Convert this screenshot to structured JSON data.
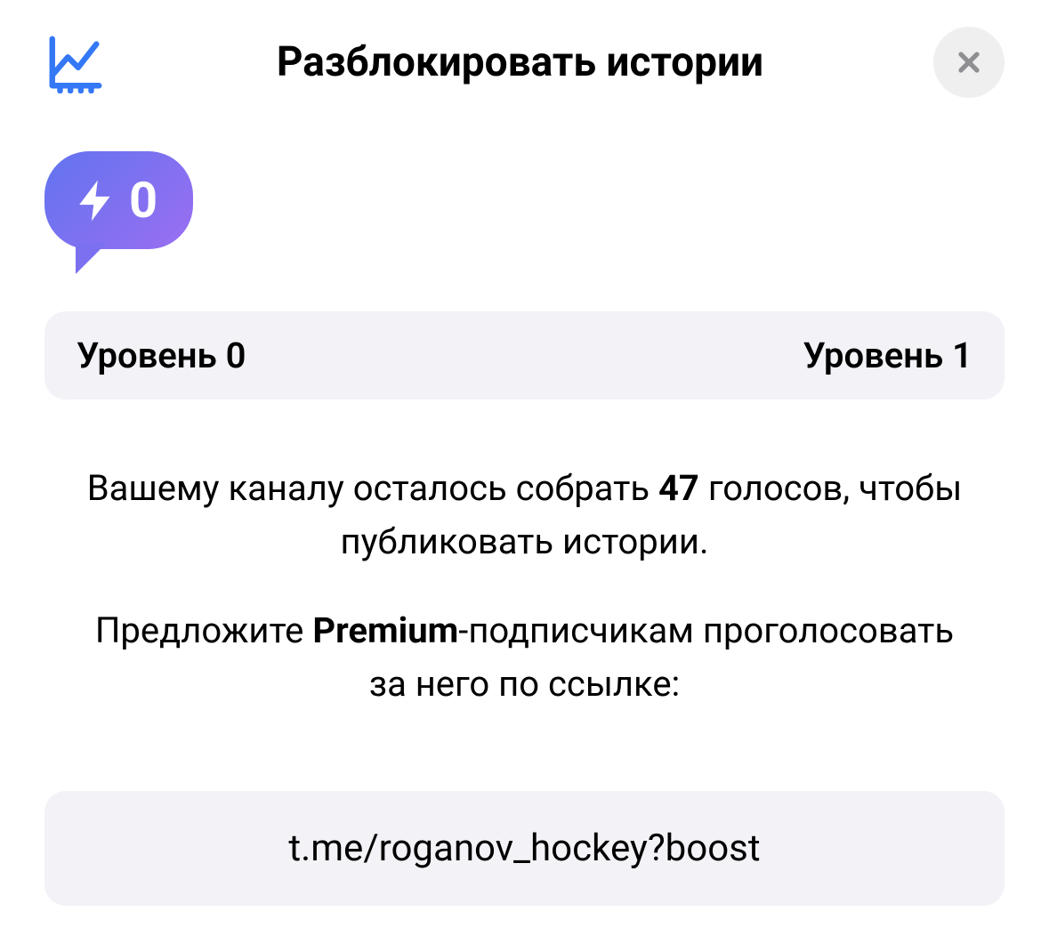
{
  "header": {
    "title": "Разблокировать истории"
  },
  "boost": {
    "count": "0"
  },
  "levels": {
    "current": "Уровень 0",
    "next": "Уровень 1"
  },
  "description": {
    "p1_pre": "Вашему каналу осталось собрать ",
    "p1_bold": "47",
    "p1_post": " голосов, чтобы публиковать истории.",
    "p2_pre": "Предложите ",
    "p2_bold": "Premium",
    "p2_post": "-подписчикам проголосовать за него по ссылке:"
  },
  "link": {
    "url": "t.me/roganov_hockey?boost"
  }
}
